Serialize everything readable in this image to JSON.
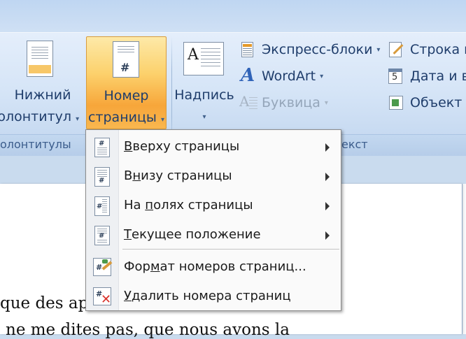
{
  "ribbon": {
    "footer_btn": {
      "line1": "Нижний",
      "line2": "колонтитул",
      "arrow": "▾"
    },
    "pagenum_btn": {
      "line1": "Номер",
      "line2": "страницы",
      "arrow": "▾"
    },
    "textbox_btn": {
      "line1": "Надпись",
      "arrow": "▾"
    },
    "express_blocks": {
      "label": "Экспресс-блоки",
      "arrow": "▾"
    },
    "wordart": {
      "label": "WordArt",
      "arrow": "▾"
    },
    "dropcap": {
      "label": "Буквица",
      "arrow": "▾"
    },
    "signature_line": {
      "label": "Строка п"
    },
    "datetime": {
      "label": "Дата и в"
    },
    "object": {
      "label": "Объект",
      "arrow": "▾"
    },
    "group_headers_footers": "олонтитулы",
    "group_text": "екст"
  },
  "menu": {
    "items": [
      {
        "pre": "",
        "u": "В",
        "post": "верху страницы",
        "submenu": true,
        "icon": "page-top-icon"
      },
      {
        "pre": "В",
        "u": "н",
        "post": "изу страницы",
        "submenu": true,
        "icon": "page-bottom-icon"
      },
      {
        "pre": "На ",
        "u": "п",
        "post": "олях страницы",
        "submenu": true,
        "icon": "page-margins-icon"
      },
      {
        "pre": "",
        "u": "Т",
        "post": "екущее положение",
        "submenu": true,
        "icon": "current-position-icon"
      },
      {
        "pre": "Фор",
        "u": "м",
        "post": "ат номеров страниц...",
        "submenu": false,
        "icon": "format-page-numbers-icon"
      },
      {
        "pre": "",
        "u": "У",
        "post": "далить номера страниц",
        "submenu": false,
        "icon": "remove-page-numbers-icon"
      }
    ]
  },
  "document": {
    "line1": "que des ap",
    "line2": "ne me dites pas, que nous avons la"
  },
  "colors": {
    "ribbon_text": "#1f3d6b",
    "active_button": "#fcd16c",
    "group_label": "#3b5c8c"
  }
}
